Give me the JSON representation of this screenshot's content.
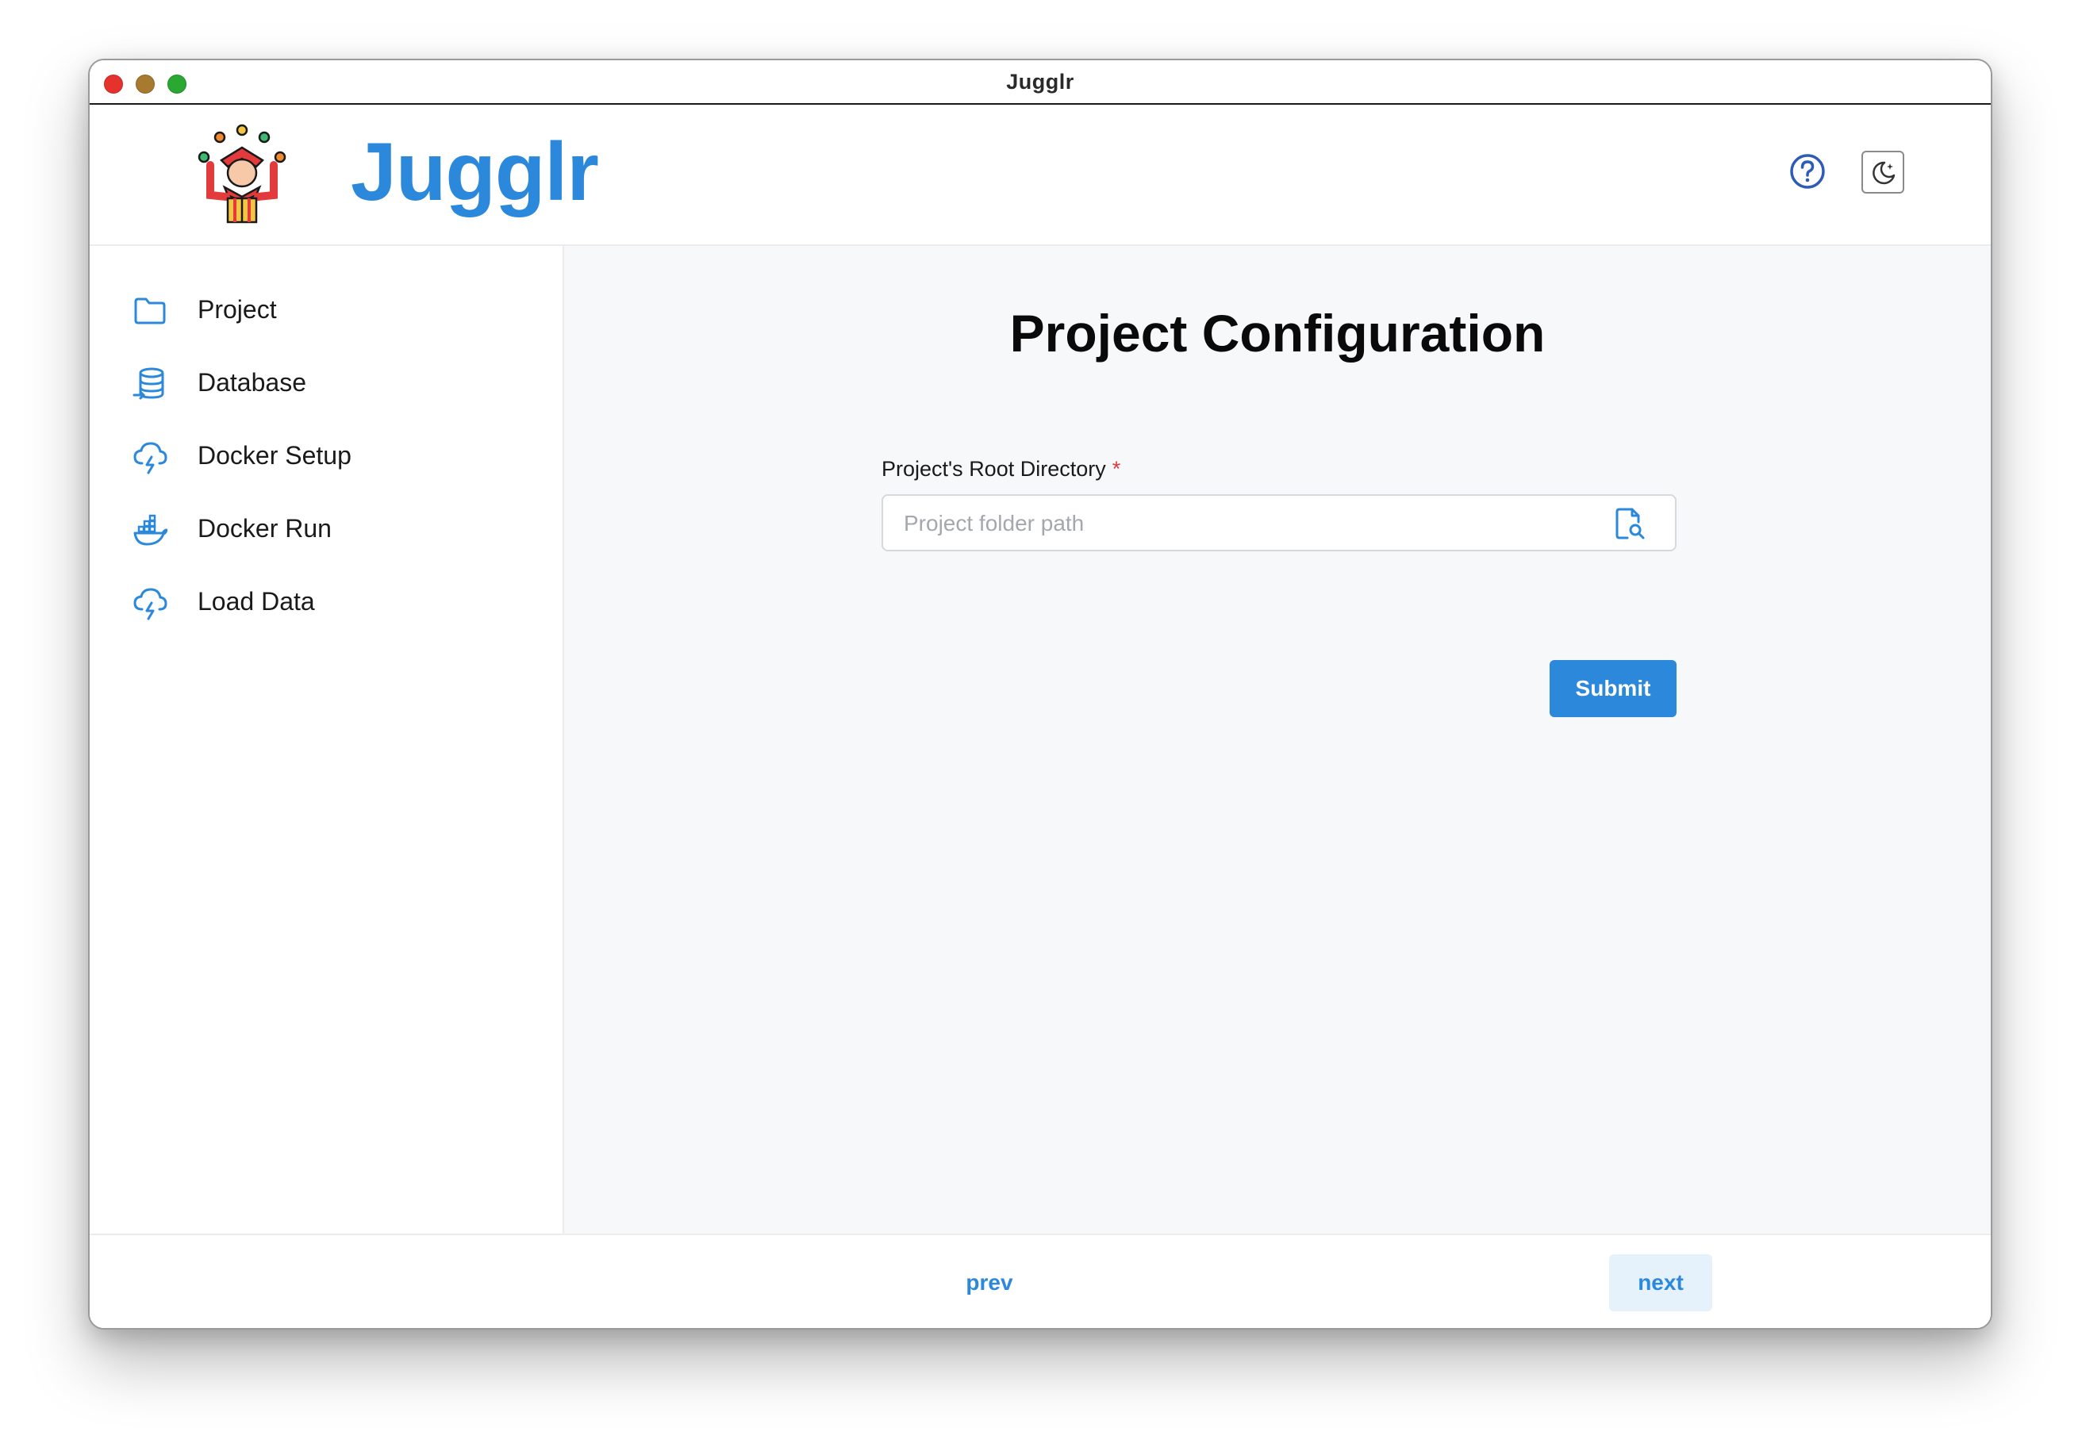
{
  "window": {
    "title": "Jugglr"
  },
  "header": {
    "brand": "Jugglr",
    "help_icon": "help-circle-icon",
    "theme_icon": "moon-icon"
  },
  "sidebar": {
    "items": [
      {
        "label": "Project",
        "icon": "folder-icon"
      },
      {
        "label": "Database",
        "icon": "database-icon"
      },
      {
        "label": "Docker Setup",
        "icon": "cloud-upload-icon"
      },
      {
        "label": "Docker Run",
        "icon": "docker-icon"
      },
      {
        "label": "Load Data",
        "icon": "cloud-upload-icon"
      }
    ]
  },
  "main": {
    "title": "Project Configuration",
    "field": {
      "label": "Project's Root Directory",
      "required_mark": "*",
      "placeholder": "Project folder path",
      "value": ""
    },
    "submit_label": "Submit"
  },
  "footer": {
    "prev_label": "prev",
    "next_label": "next"
  },
  "colors": {
    "accent": "#2b88db",
    "required": "#e0393a",
    "main_bg": "#f7f8fa",
    "next_bg": "#e6f2fb"
  }
}
